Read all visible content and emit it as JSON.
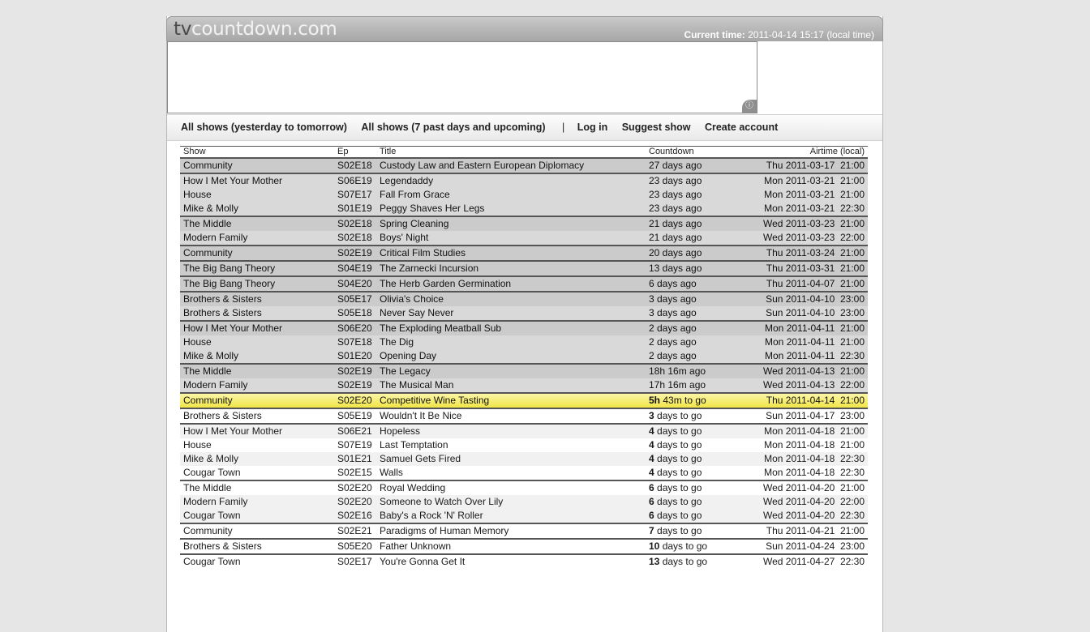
{
  "site": {
    "logo_tv": "tv",
    "logo_rest": "countdown.com",
    "time_label": "Current time:",
    "time_value": "2011-04-14 15:17 (local time)"
  },
  "nav": {
    "yesterday_tomorrow": "All shows (yesterday to tomorrow)",
    "seven_days": "All shows (7 past days and upcoming)",
    "separator": "|",
    "login": "Log in",
    "suggest": "Suggest show",
    "create": "Create account"
  },
  "ad": {
    "info_icon": "info-icon"
  },
  "table": {
    "headers": {
      "show": "Show",
      "ep": "Ep",
      "title": "Title",
      "countdown": "Countdown",
      "airtime": "Airtime (local)"
    },
    "rows": [
      {
        "show": "Community",
        "ep": "S02E18",
        "title": "Custody Law and Eastern European Diplomacy",
        "cd_num": "",
        "cd_text": "27 days ago",
        "air": "Thu 2011-03-17  21:00"
      },
      {
        "show": "How I Met Your Mother",
        "ep": "S06E19",
        "title": "Legendaddy",
        "cd_num": "",
        "cd_text": "23 days ago",
        "air": "Mon 2011-03-21  21:00"
      },
      {
        "show": "House",
        "ep": "S07E17",
        "title": "Fall From Grace",
        "cd_num": "",
        "cd_text": "23 days ago",
        "air": "Mon 2011-03-21  21:00"
      },
      {
        "show": "Mike & Molly",
        "ep": "S01E19",
        "title": "Peggy Shaves Her Legs",
        "cd_num": "",
        "cd_text": "23 days ago",
        "air": "Mon 2011-03-21  22:30"
      },
      {
        "show": "The Middle",
        "ep": "S02E18",
        "title": "Spring Cleaning",
        "cd_num": "",
        "cd_text": "21 days ago",
        "air": "Wed 2011-03-23  21:00"
      },
      {
        "show": "Modern Family",
        "ep": "S02E18",
        "title": "Boys' Night",
        "cd_num": "",
        "cd_text": "21 days ago",
        "air": "Wed 2011-03-23  22:00"
      },
      {
        "show": "Community",
        "ep": "S02E19",
        "title": "Critical Film Studies",
        "cd_num": "",
        "cd_text": "20 days ago",
        "air": "Thu 2011-03-24  21:00"
      },
      {
        "show": "The Big Bang Theory",
        "ep": "S04E19",
        "title": "The Zarnecki Incursion",
        "cd_num": "",
        "cd_text": "13 days ago",
        "air": "Thu 2011-03-31  21:00"
      },
      {
        "show": "The Big Bang Theory",
        "ep": "S04E20",
        "title": "The Herb Garden Germination",
        "cd_num": "",
        "cd_text": "6 days ago",
        "air": "Thu 2011-04-07  21:00"
      },
      {
        "show": "Brothers & Sisters",
        "ep": "S05E17",
        "title": "Olivia's Choice",
        "cd_num": "",
        "cd_text": "3 days ago",
        "air": "Sun 2011-04-10  23:00"
      },
      {
        "show": "Brothers & Sisters",
        "ep": "S05E18",
        "title": "Never Say Never",
        "cd_num": "",
        "cd_text": "3 days ago",
        "air": "Sun 2011-04-10  23:00"
      },
      {
        "show": "How I Met Your Mother",
        "ep": "S06E20",
        "title": "The Exploding Meatball Sub",
        "cd_num": "",
        "cd_text": "2 days ago",
        "air": "Mon 2011-04-11  21:00"
      },
      {
        "show": "House",
        "ep": "S07E18",
        "title": "The Dig",
        "cd_num": "",
        "cd_text": "2 days ago",
        "air": "Mon 2011-04-11  21:00"
      },
      {
        "show": "Mike & Molly",
        "ep": "S01E20",
        "title": "Opening Day",
        "cd_num": "",
        "cd_text": "2 days ago",
        "air": "Mon 2011-04-11  22:30"
      },
      {
        "show": "The Middle",
        "ep": "S02E19",
        "title": "The Legacy",
        "cd_num": "",
        "cd_text": "18h 16m ago",
        "air": "Wed 2011-04-13  21:00"
      },
      {
        "show": "Modern Family",
        "ep": "S02E19",
        "title": "The Musical Man",
        "cd_num": "",
        "cd_text": "17h 16m ago",
        "air": "Wed 2011-04-13  22:00"
      },
      {
        "show": "Community",
        "ep": "S02E20",
        "title": "Competitive Wine Tasting",
        "cd_num": "5h",
        "cd_text": " 43m to go",
        "air": "Thu 2011-04-14  21:00"
      },
      {
        "show": "Brothers & Sisters",
        "ep": "S05E19",
        "title": "Wouldn't It Be Nice",
        "cd_num": "3",
        "cd_text": " days to go",
        "air": "Sun 2011-04-17  23:00"
      },
      {
        "show": "How I Met Your Mother",
        "ep": "S06E21",
        "title": "Hopeless",
        "cd_num": "4",
        "cd_text": " days to go",
        "air": "Mon 2011-04-18  21:00"
      },
      {
        "show": "House",
        "ep": "S07E19",
        "title": "Last Temptation",
        "cd_num": "4",
        "cd_text": " days to go",
        "air": "Mon 2011-04-18  21:00"
      },
      {
        "show": "Mike & Molly",
        "ep": "S01E21",
        "title": "Samuel Gets Fired",
        "cd_num": "4",
        "cd_text": " days to go",
        "air": "Mon 2011-04-18  22:30"
      },
      {
        "show": "Cougar Town",
        "ep": "S02E15",
        "title": "Walls",
        "cd_num": "4",
        "cd_text": " days to go",
        "air": "Mon 2011-04-18  22:30"
      },
      {
        "show": "The Middle",
        "ep": "S02E20",
        "title": "Royal Wedding",
        "cd_num": "6",
        "cd_text": " days to go",
        "air": "Wed 2011-04-20  21:00"
      },
      {
        "show": "Modern Family",
        "ep": "S02E20",
        "title": "Someone to Watch Over Lily",
        "cd_num": "6",
        "cd_text": " days to go",
        "air": "Wed 2011-04-20  22:00"
      },
      {
        "show": "Cougar Town",
        "ep": "S02E16",
        "title": "Baby's a Rock 'N' Roller",
        "cd_num": "6",
        "cd_text": " days to go",
        "air": "Wed 2011-04-20  22:30"
      },
      {
        "show": "Community",
        "ep": "S02E21",
        "title": "Paradigms of Human Memory",
        "cd_num": "7",
        "cd_text": " days to go",
        "air": "Thu 2011-04-21  21:00"
      },
      {
        "show": "Brothers & Sisters",
        "ep": "S05E20",
        "title": "Father Unknown",
        "cd_num": "10",
        "cd_text": " days to go",
        "air": "Sun 2011-04-24  23:00"
      },
      {
        "show": "Cougar Town",
        "ep": "S02E17",
        "title": "You're Gonna Get It",
        "cd_num": "13",
        "cd_text": " days to go",
        "air": "Wed 2011-04-27  22:30"
      }
    ]
  }
}
